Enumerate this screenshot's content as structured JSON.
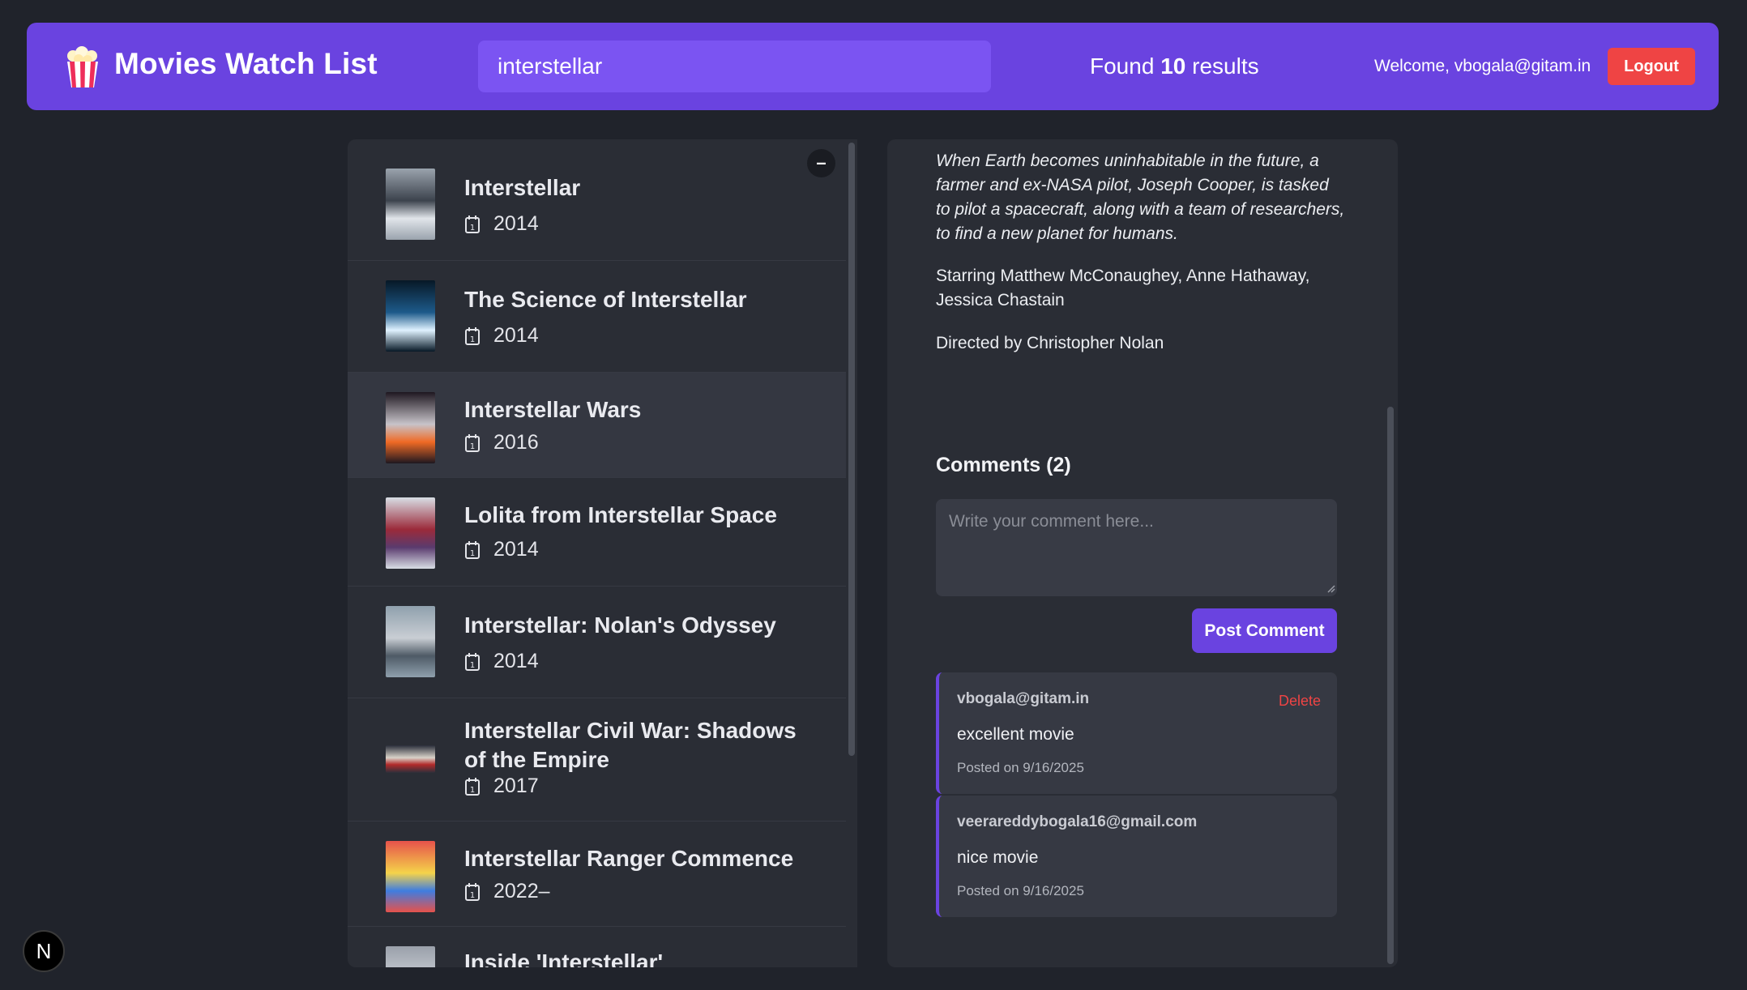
{
  "header": {
    "logo_icon": "popcorn-icon",
    "title": "Movies Watch List",
    "search_value": "interstellar",
    "found_prefix": "Found",
    "found_count": "10",
    "found_suffix": "results",
    "welcome": "Welcome, vbogala@gitam.in",
    "logout_label": "Logout",
    "accent_color": "#6a43e0"
  },
  "list": {
    "collapse_label": "–",
    "movies": [
      {
        "title": "Interstellar",
        "year": "2014",
        "poster_colors": [
          "#9aa3ad",
          "#e1e5ea",
          "#3c434d"
        ]
      },
      {
        "title": "The Science of Interstellar",
        "year": "2014",
        "poster_colors": [
          "#071826",
          "#dff2ff",
          "#1d5a8a"
        ]
      },
      {
        "title": "Interstellar Wars",
        "year": "2016",
        "poster_colors": [
          "#1e1720",
          "#f06a25",
          "#c7c3c9"
        ]
      },
      {
        "title": "Lolita from Interstellar Space",
        "year": "2014",
        "poster_colors": [
          "#d8dee5",
          "#5a3b6e",
          "#9b2a3a"
        ]
      },
      {
        "title": "Interstellar: Nolan's Odyssey",
        "year": "2014",
        "poster_colors": [
          "#8fa0ad",
          "#4e5a66",
          "#c9ced4"
        ]
      },
      {
        "title": "Interstellar Civil War: Shadows of the Empire",
        "year": "2017",
        "poster_colors": [
          "#2b2f3b",
          "#b22a2a",
          "#d8d2c8"
        ]
      },
      {
        "title": "Interstellar Ranger Commence",
        "year": "2022–",
        "poster_colors": [
          "#e6524b",
          "#3f7de0",
          "#f5d34a"
        ]
      },
      {
        "title": "Inside 'Interstellar'",
        "year": "",
        "poster_colors": [
          "#9aa0aa",
          "#6a6f79",
          "#c7ccd3"
        ]
      }
    ]
  },
  "detail": {
    "plot": "When Earth becomes uninhabitable in the future, a farmer and ex-NASA pilot, Joseph Cooper, is tasked to pilot a spacecraft, along with a team of researchers, to find a new planet for humans.",
    "starring": "Starring Matthew McConaughey, Anne Hathaway, Jessica Chastain",
    "directed": "Directed by Christopher Nolan",
    "comments_heading": "Comments (2)",
    "comment_placeholder": "Write your comment here...",
    "post_label": "Post Comment",
    "comments": [
      {
        "author": "vbogala@gitam.in",
        "text": "excellent movie",
        "date": "Posted on 9/16/2025",
        "delete_label": "Delete"
      },
      {
        "author": "veerareddybogala16@gmail.com",
        "text": "nice movie",
        "date": "Posted on 9/16/2025",
        "delete_label": ""
      }
    ]
  },
  "badge": {
    "label": "N"
  }
}
